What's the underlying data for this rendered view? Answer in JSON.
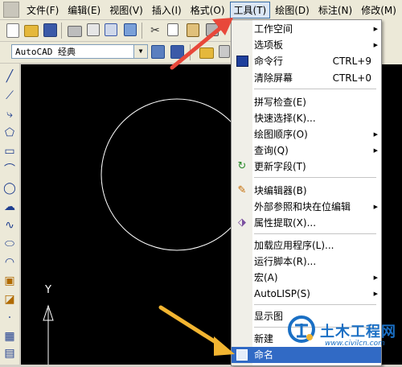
{
  "menubar": {
    "items": [
      {
        "label": "文件(F)"
      },
      {
        "label": "编辑(E)"
      },
      {
        "label": "视图(V)"
      },
      {
        "label": "插入(I)"
      },
      {
        "label": "格式(O)"
      },
      {
        "label": "工具(T)",
        "active": true
      },
      {
        "label": "绘图(D)"
      },
      {
        "label": "标注(N)"
      },
      {
        "label": "修改(M)"
      }
    ]
  },
  "toolbar": {
    "workspace_value": "AutoCAD 经典"
  },
  "tools_menu": {
    "items": [
      {
        "label": "工作空间",
        "submenu": true
      },
      {
        "label": "选项板",
        "submenu": true
      },
      {
        "label": "命令行",
        "shortcut": "CTRL+9",
        "icon": "command-line-icon"
      },
      {
        "label": "清除屏幕",
        "shortcut": "CTRL+0"
      },
      {
        "label": "拼写检查(E)",
        "icon": "spell-check-icon"
      },
      {
        "label": "快速选择(K)..."
      },
      {
        "label": "绘图顺序(O)",
        "submenu": true
      },
      {
        "label": "查询(Q)",
        "submenu": true
      },
      {
        "label": "更新字段(T)",
        "icon": "update-field-icon"
      },
      {
        "label": "块编辑器(B)",
        "icon": "block-editor-icon"
      },
      {
        "label": "外部参照和块在位编辑",
        "submenu": true
      },
      {
        "label": "属性提取(X)...",
        "icon": "attribute-extract-icon"
      },
      {
        "label": "加载应用程序(L)..."
      },
      {
        "label": "运行脚本(R)..."
      },
      {
        "label": "宏(A)",
        "submenu": true
      },
      {
        "label": "AutoLISP(S)",
        "submenu": true
      },
      {
        "label": "显示图"
      },
      {
        "label": "新建"
      },
      {
        "label": "命名",
        "icon": "named-ucs-icon",
        "highlighted": true
      }
    ]
  },
  "drawing": {
    "ucs_y_label": "Y"
  },
  "watermark": {
    "title": "土木工程网",
    "url": "www.civilcn.com"
  },
  "colors": {
    "menu_highlight": "#316ac5",
    "arrow": "#e8483a",
    "arrow_yellow": "#f2b531",
    "canvas": "#000000"
  }
}
